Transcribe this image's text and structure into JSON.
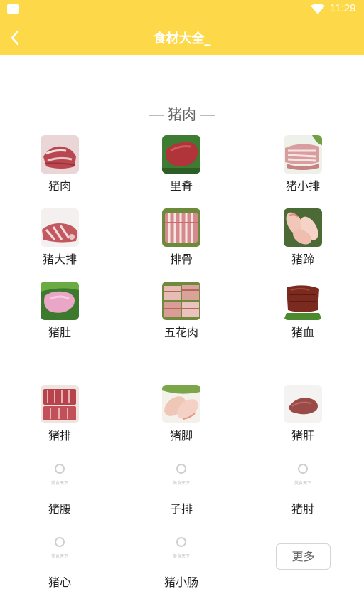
{
  "status_bar": {
    "time": "11:29"
  },
  "header": {
    "title": "食材大全_"
  },
  "section": {
    "title": "猪肉"
  },
  "items": [
    {
      "label": "猪肉"
    },
    {
      "label": "里脊"
    },
    {
      "label": "猪小排"
    },
    {
      "label": "猪大排"
    },
    {
      "label": "排骨"
    },
    {
      "label": "猪蹄"
    },
    {
      "label": "猪肚"
    },
    {
      "label": "五花肉"
    },
    {
      "label": "猪血"
    },
    {
      "label": "猪排"
    },
    {
      "label": "猪脚"
    },
    {
      "label": "猪肝"
    },
    {
      "label": "猪腰",
      "placeholder_watermark": "美食天下"
    },
    {
      "label": "子排",
      "placeholder_watermark": "美食天下"
    },
    {
      "label": "猪肘",
      "placeholder_watermark": "美食天下"
    },
    {
      "label": "猪心",
      "placeholder_watermark": "美食天下"
    },
    {
      "label": "猪小肠",
      "placeholder_watermark": "美食天下"
    }
  ],
  "more_button": {
    "label": "更多"
  },
  "colors": {
    "accent": "#fdd94a",
    "text": "#222222",
    "muted": "#666666"
  }
}
